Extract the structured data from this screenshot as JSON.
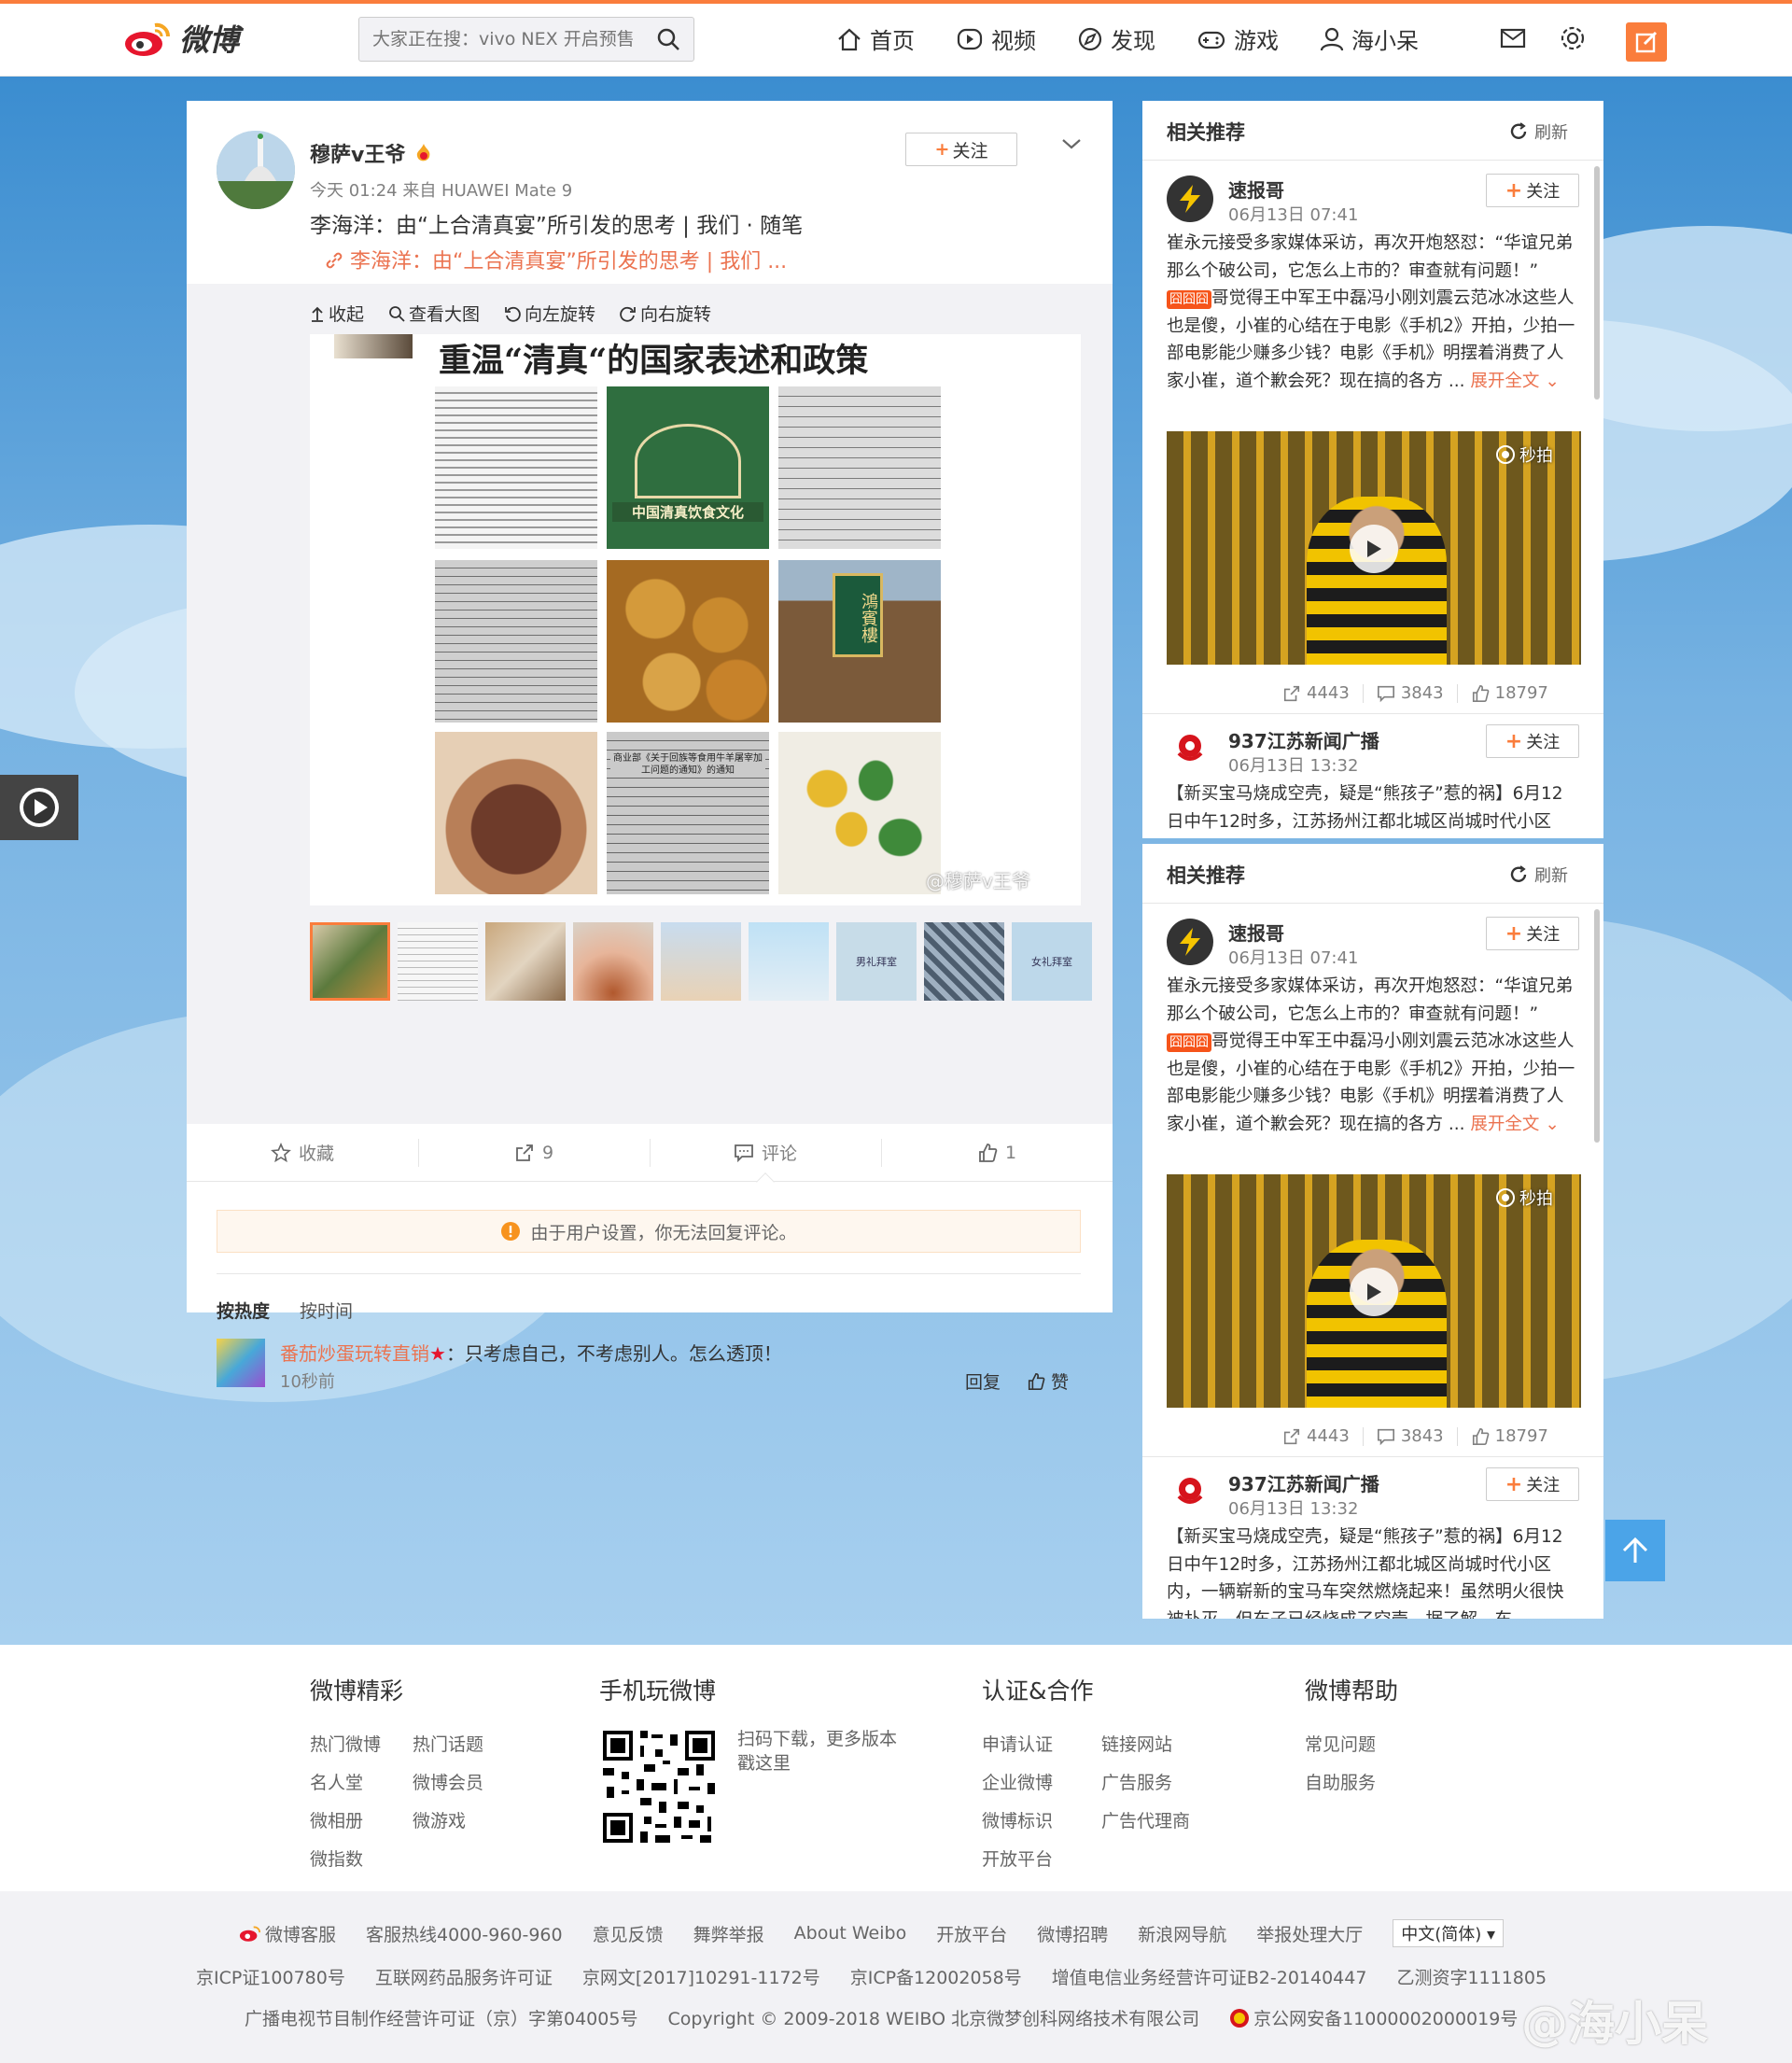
{
  "nav": {
    "logo_text": "微博",
    "search_placeholder": "大家正在搜：vivo NEX 开启预售",
    "links": [
      "首页",
      "视频",
      "发现",
      "游戏",
      "海小呆"
    ]
  },
  "post": {
    "username": "穆萨v王爷",
    "meta": "今天 01:24 来自 HUAWEI Mate 9",
    "text": "李海洋：由“上合清真宴”所引发的思考 | 我们 · 随笔",
    "link_text": "李海洋：由“上合清真宴”所引发的思考 | 我们 ...",
    "follow_label": "关注",
    "media_tools": [
      "收起",
      "查看大图",
      "向左旋转",
      "向右旋转"
    ],
    "image_title": "重温“清真“的国家表述和政策",
    "image_cells": [
      {
        "caption": ""
      },
      {
        "caption": "中国清真饮食文化"
      },
      {
        "caption": ""
      },
      {
        "caption": ""
      },
      {
        "caption": ""
      },
      {
        "caption": "鴻賓樓"
      },
      {
        "caption": ""
      },
      {
        "caption": "商业部《关于回族等食用牛羊屠宰加工问题的通知》的通知"
      },
      {
        "caption": ""
      }
    ],
    "image_watermark": "@穆萨v王爷",
    "thumb_labels": [
      "",
      "",
      "",
      "",
      "",
      "",
      "男礼拜室",
      "",
      "女礼拜室"
    ],
    "actions": {
      "fav": "收藏",
      "repost": "9",
      "comment": "评论",
      "like": "1"
    },
    "warning": "由于用户设置，你无法回复评论。",
    "sort_hot": "按热度",
    "sort_time": "按时间",
    "comment": {
      "user": "番茄炒蛋玩转直销",
      "text": "：只考虑自己，不考虑别人。怎么透顶！",
      "time": "10秒前",
      "reply": "回复",
      "like": "赞"
    }
  },
  "sidebar": {
    "title": "相关推荐",
    "refresh": "刷新",
    "feed1": {
      "name": "速报哥",
      "time": "06月13日 07:41",
      "follow": "关注",
      "text_a": "崔永元接受多家媒体采访，再次开炮怒怼：“华谊兄弟那么个破公司，它怎么上市的？审查就有问题！”",
      "tag": "囧囧囧",
      "text_b": "哥觉得王中军王中磊冯小刚刘震云范冰冰这些人也是傻，小崔的心结在于电影《手机2》开拍，少拍一部电影能少赚多少钱？电影《手机》明摆着消费了人家小崔，道个歉会死？现在搞的各方 ...",
      "expand": "展开全文",
      "video_badge": "秒拍",
      "reposts": "4443",
      "comments": "3843",
      "likes": "18797"
    },
    "feed2": {
      "name": "937江苏新闻广播",
      "time": "06月13日 13:32",
      "follow": "关注",
      "text": "【新买宝马烧成空壳，疑是“熊孩子”惹的祸】6月12日中午12时多，江苏扬州江都北城区尚城时代小区内，一辆崭新的宝马车突然燃烧起来！虽然明火很快被扑灭，但车子已经烧成了空壳。据了解，车"
    }
  },
  "footer": {
    "col1_title": "微博精彩",
    "col1_links": [
      "热门微博",
      "热门话题",
      "名人堂",
      "微博会员",
      "微相册",
      "微游戏",
      "微指数"
    ],
    "col2_title": "手机玩微博",
    "col2_text": "扫码下载，更多版本戳这里",
    "col3_title": "认证&合作",
    "col3_links": [
      "申请认证",
      "链接网站",
      "企业微博",
      "广告服务",
      "微博标识",
      "广告代理商",
      "开放平台"
    ],
    "col4_title": "微博帮助",
    "col4_links": [
      "常见问题",
      "自助服务"
    ],
    "row1": [
      "微博客服",
      "客服热线4000-960-960",
      "意见反馈",
      "舞弊举报",
      "About Weibo",
      "开放平台",
      "微博招聘",
      "新浪网导航",
      "举报处理大厅"
    ],
    "lang": "中文(简体)",
    "row2": [
      "京ICP证100780号",
      "互联网药品服务许可证",
      "京网文[2017]10291-1172号",
      "京ICP备12002058号",
      "增值电信业务经营许可证B2-20140447",
      "乙测资字1111805"
    ],
    "row3": [
      "广播电视节目制作经营许可证（京）字第04005号",
      "Copyright © 2009-2018 WEIBO 北京微梦创科网络技术有限公司",
      "京公网安备11000002000019号"
    ],
    "watermark": "@海小呆"
  },
  "colors": {
    "accent": "#fa7d3c",
    "link": "#eb7350",
    "sky": "#76b2e2"
  }
}
